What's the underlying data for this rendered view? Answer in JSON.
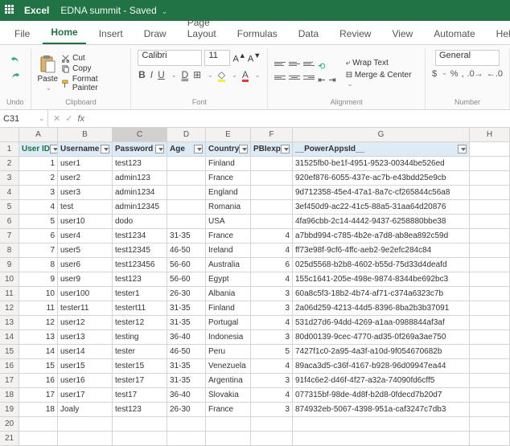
{
  "titlebar": {
    "app": "Excel",
    "doc": "EDNA summit",
    "status": "- Saved"
  },
  "tabs": [
    "File",
    "Home",
    "Insert",
    "Draw",
    "Page Layout",
    "Formulas",
    "Data",
    "Review",
    "View",
    "Automate",
    "Help"
  ],
  "active_tab": "Home",
  "ribbon": {
    "undo_label": "Undo",
    "clipboard": {
      "paste": "Paste",
      "cut": "Cut",
      "copy": "Copy",
      "format_painter": "Format Painter",
      "label": "Clipboard"
    },
    "font": {
      "name": "Calibri",
      "size": "11",
      "label": "Font"
    },
    "alignment": {
      "wrap": "Wrap Text",
      "merge": "Merge & Center",
      "label": "Alignment"
    },
    "number": {
      "format": "General",
      "label": "Number"
    }
  },
  "namebox": "C31",
  "columns": [
    "A",
    "B",
    "C",
    "D",
    "E",
    "F",
    "G",
    "H"
  ],
  "headers": [
    "User ID",
    "Username",
    "Password",
    "Age",
    "Country",
    "PBIexp",
    "__PowerAppsId__"
  ],
  "rows": [
    [
      "1",
      "user1",
      "test123",
      "",
      "Finland",
      "",
      "31525fb0-be1f-4951-9523-00344be526ed"
    ],
    [
      "2",
      "user2",
      "admin123",
      "",
      "France",
      "",
      "920ef876-6055-437e-ac7b-e43bdd25e9cb"
    ],
    [
      "3",
      "user3",
      "admin1234",
      "",
      "England",
      "",
      "9d712358-45e4-47a1-8a7c-cf265844c56a8"
    ],
    [
      "4",
      "test",
      "admin12345",
      "",
      "Romania",
      "",
      "3ef450d9-ac22-41c5-88a5-31aa64d20876"
    ],
    [
      "5",
      "user10",
      "dodo",
      "",
      "USA",
      "",
      "4fa96cbb-2c14-4442-9437-6258880bbe38"
    ],
    [
      "6",
      "user4",
      "test1234",
      "31-35",
      "France",
      "4",
      "a7bbd994-c785-4b2e-a7d8-ab8ea892c59d"
    ],
    [
      "7",
      "user5",
      "test12345",
      "46-50",
      "Ireland",
      "4",
      "ff73e98f-9cf6-4ffc-aeb2-9e2efc284c84"
    ],
    [
      "8",
      "user6",
      "test123456",
      "56-60",
      "Australia",
      "6",
      "025d5568-b2b8-4602-b55d-75d33d4deafd"
    ],
    [
      "9",
      "user9",
      "test123",
      "56-60",
      "Egypt",
      "4",
      "155c1641-205e-498e-9874-8344be692bc3"
    ],
    [
      "10",
      "user100",
      "tester1",
      "26-30",
      "Albania",
      "3",
      "60a8c5f3-18b2-4b74-af71-c374a6323c7b"
    ],
    [
      "11",
      "tester11",
      "testert11",
      "31-35",
      "Finland",
      "3",
      "2a06d259-4213-44d5-8396-8ba2b3b37091"
    ],
    [
      "12",
      "user12",
      "tester12",
      "31-35",
      "Portugal",
      "4",
      "531d27d6-94dd-4269-a1aa-0988844af3af"
    ],
    [
      "13",
      "user13",
      "testing",
      "36-40",
      "Indonesia",
      "3",
      "80d00139-9cec-4770-ad35-0f269a3ae750"
    ],
    [
      "14",
      "user14",
      "tester",
      "46-50",
      "Peru",
      "5",
      "7427f1c0-2a95-4a3f-a10d-9f054670682b"
    ],
    [
      "15",
      "user15",
      "tester15",
      "31-35",
      "Venezuela",
      "4",
      "89aca3d5-c36f-4167-b928-96d09947ea44"
    ],
    [
      "16",
      "user16",
      "tester17",
      "31-35",
      "Argentina",
      "3",
      "91f4c6e2-d46f-4f27-a32a-74090fd6cff5"
    ],
    [
      "17",
      "user17",
      "test17",
      "36-40",
      "Slovakia",
      "4",
      "077315bf-98de-4d8f-b2d8-0fdecd7b20d7"
    ],
    [
      "18",
      "Joaly",
      "test123",
      "26-30",
      "France",
      "3",
      "874932eb-5067-4398-951a-caf3247c7db3"
    ]
  ]
}
